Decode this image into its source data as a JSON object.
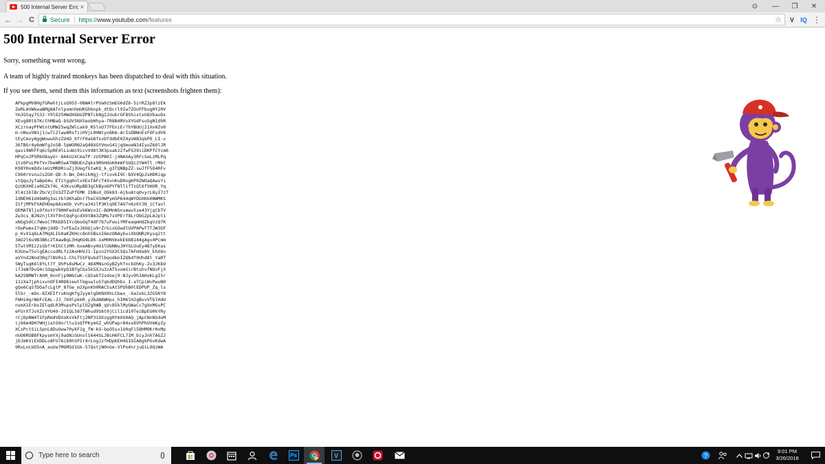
{
  "browser": {
    "tab_title": "500 Internal Server Error",
    "tab_close": "×",
    "nav": {
      "back": "←",
      "forward": "→",
      "reload": "C"
    },
    "window": {
      "account": "⊙",
      "minimize": "—",
      "maximize": "❐",
      "close": "✕"
    },
    "omnibox": {
      "secure_label": "Secure",
      "url_scheme": "https://",
      "url_host": "www.youtube.com",
      "url_path": "/features",
      "bookmark_star": "☆"
    },
    "extensions": {
      "v": "V",
      "iq": "IQ",
      "menu": "⋮"
    }
  },
  "page": {
    "heading": "500 Internal Server Error",
    "line1": "Sorry, something went wrong.",
    "line2": "A team of highly trained monkeys has been dispatched to deal with this situation.",
    "line3": "If you see them, send them this information as text (screenshots frighten them):",
    "debug_lines": [
      "APkpgMV8HgfGRehtjLsQ955-0BWAlrPUa0zSmEG6dZ6-5zrRZJp8lzEk",
      "ZeRLAVWkwaBMg8ATnlpomnhmUKGhbnpk_dtDcrl9Iw7ZOoFFbugHY20V",
      "YmJGSqy7S3J-Y9lD25HWdX6bUZPNTckNgIJUubrGF8ShistxUQVbavDx",
      "XEvg8Rtb7KcthMBaQ-bSOV5NXSeobHhya-fR8N4RVvXYGdFsuSgN1dhR",
      "XCzrnayPFWtntUMW25wqZWlLak9_R5loO77FEniEr7hYBUUj21Xn0Zo0",
      "m-nNuuVW1j1iw7i2lww8RsfiiHVjL0HWtyo6Km-ArIsDBWnEsFOFsdV6",
      "tEyCmxyAggWowuGhzZU4D_bfrF0aG8fxvDfddbE0Z4yU4B3qkPO_LI-v",
      "36TBGr4y6mWfgJo5B-5pWGRN2aQ48XGYVmxG41jqUmoeN14IyuZ6OlJR",
      "qavi9WhFFq6cSpRE4lLsuWi9icvVd8t3K3psakz2fwFG39iiDKPfCYcm6",
      "HPqCx2P5RbO8ayUr-8AkUzXCmaTP-zU5PB0I-j4NAXAy3RFcSeLzMLPq",
      "1tz6PsLP6fVx7beWR5wATNBUEnZqkx9RhHdoK0mmFSUQi2YW4Tl_rM6t",
      "K98YHxmDdxieUzMRDRiuZj3UegfGtwKQ_k_g3TQNBpZZ-swJfF5O4RFv",
      "C960rVsnuJsZG0-QD-h-Bm_D4nikHgj-tfiovkI9C-bXV4QpJsHDRiqp",
      "vtQquJyfaBpO4u_ETztgq0nlxXEoTAFcT4XvnKuD0ogKP0ZWOaQAwsYi",
      "QzUKXHEia0GZk74L_43KvsURpBD3gCkByo6PYfNllifTzQl6fSHUR_Yq",
      "Xl4z1blBrZbcVjIU3ZTZuPfEMK IbNuX_O9k83-AjbuAtq0vyrL8yI7zT",
      "IdNEH61U4bW0g3sLtblOKhaDnr7heCXG0WPym5P644qWYDUXKk0NWMKS",
      "ISfjMPkFXAEHDep8AzmOb_VvPca34zlP3Ktq9E7AU7n6z6YJN_1Cfavl",
      "OEMAT8ljs0fXotY79HHFedxEvkKWzn1C-BOMnNSnsmwv5ze43YjqCbTV",
      "Zw3cs_BJN2njlXVf9nCQqFgcdX9tBm3ZQMs7sVPErf8LrObGZpLAJpt1",
      "xNGgSdCc7WwsC7RkbD5IYcGboOqT4dF7b7uFwuiYMFeaqmHdZkqVzQ7K",
      "rDwPwmxI7qNnjddD-7vFEaZxJ6OQju9rZrGixGOwdlUVPAPwf7TJW3GF",
      "p_KvX1q6LA7MqXLIG0aKZKHcc8nhSBsnI6mzONAybuiXbONRzKyxq2tt",
      "3AO2l6u9B3B6c2TAawBqL3HqKOdLD6-oxM0NVmxkE6bB144gAgv4Pcmm",
      "5TwlVMIz2sSbfrKIhCtzMR-bxeABvyHU1lUbNNuJHYGLOuEy4B7yEKas",
      "K3Unw75olgEAccudRLfz2AxHHVJ1-Ipzn2YGX3CSQs7AFm9a8V_khX6n",
      "aVYnd2Nnd3Rq7lNV0s1-ChLTSSFQubdTlbqodmnIZQbdf0Uhd8l_YaRT",
      "5WyTuqK6l8YLt7f_OhPs8sMwCz_46XMNsnGyBZyhfnckOhKy-Zv3JKbO",
      "i7JeW7DvQ4c1OqpwbVpQ1BfgCbx5kSXJu3zATSvomSirBtshvfNOvFjX",
      "kA2SNMWTrAhM_6nnFjp9WbCwK-cQ5akT2sdoej9-NJyv9hJAHxKLgI5r",
      "11zXa7jphixvnOFI4RD8iewlTmguwlu57qkdDQhbs_I-aTCpiWvPwuN0",
      "gQe6CqSfDOafcLgtP_8fGe_m2XpnKhHRACSsAt5POhB0lEDPUP_Zq_ls",
      "5lbr_-mOx-8IXEIfruKngKfgJyymlgDKNX0hLCbex_-Xa2xkL3ZG5KY8",
      "FWH14grN6FcEAL-JJ_769lpkkR_yJbdAKWHps_hIM6lHJgBvvVTblHdU",
      "nsmX1ErbsIElqdLR3MspxPslplUZghWB_qVc85klMyGWaCc7gXnMGsPC",
      "eFUrXTJvXZcVYU49-2OIQL587TWhud9S6t0jCil1cd10TeiBpEU0kYRy",
      "rCjDpNW4T1FpRmdVDXoKsVkFtj2NP31OXzgg0YmXG0AQ_jApCNnNSduM",
      "ij66m4DH7WHjiatG9orltu1sQfPKymGZ_whUPapr84xs8VhPhUVmKyZy",
      "XCxPctSiL5pnL8DuUww70ykF1g_fW-kG-bpO5sx1U0qFi58HM9KrHxMp",
      "nUO6RUB8FkpysmYXj9aONiGUnol1644SLJBcH6FCL7IM_biyJnh7AGZJ",
      "jDJmKViEXDDLo8FU7Aib0hSPIr4rLngJzfHDpKEH4GIOIA8gkPGxKdwA",
      "9RxLnLUO5nA_auUe7MGMSd1Gk-57QxtjN0nGe-VlPo4nrjuQiL9QzWA"
    ]
  },
  "taskbar": {
    "search_placeholder": "Type here to search",
    "clock_time": "9:01 PM",
    "clock_date": "3/26/2018",
    "apps": [
      "store-icon",
      "music-icon",
      "calendar-icon",
      "edge-icon",
      "photoshop-icon",
      "chrome-icon",
      "visual-studio-icon",
      "github-icon",
      "ccleaner-icon",
      "mail-icon"
    ],
    "photoshop_label": "Ps",
    "vs_label": "V"
  },
  "colors": {
    "secure_green": "#0b8043",
    "youtube_red": "#e62117",
    "monkey_purple": "#7b3fa3",
    "monkey_face": "#f5c84c",
    "hat_red": "#d93025",
    "taskbar_bg": "#0f0f0f"
  }
}
